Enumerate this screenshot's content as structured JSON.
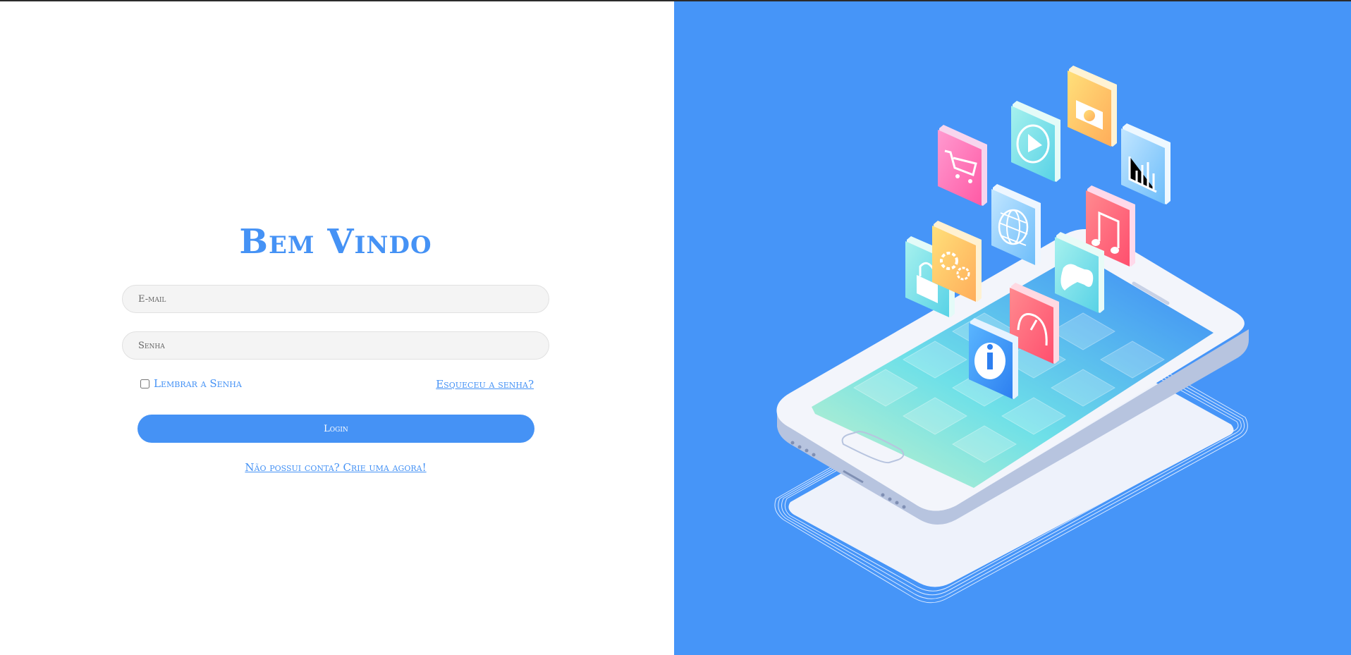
{
  "title": "Bem Vindo",
  "form": {
    "email_placeholder": "E-mail",
    "password_placeholder": "Senha",
    "remember_label": "Lembrar a Senha",
    "forgot_link": "Esqueceu a senha?",
    "login_button": "Login",
    "signup_link": "Não possui conta? Crie uma agora!"
  },
  "colors": {
    "accent": "#4592f5",
    "right_panel_bg": "#4695f8",
    "input_bg": "#f4f4f4"
  },
  "illustration": {
    "subject": "isometric smartphone with floating app icons",
    "icons": [
      "shopping-cart-icon",
      "play-icon",
      "camera-icon",
      "bar-chart-icon",
      "globe-icon",
      "music-icon",
      "lock-icon",
      "gear-icon",
      "gamepad-icon",
      "speedometer-icon",
      "info-icon"
    ]
  }
}
